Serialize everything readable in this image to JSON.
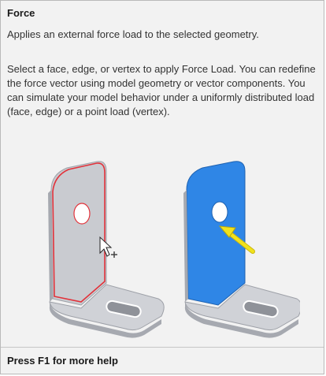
{
  "tooltip": {
    "title": "Force",
    "summary": "Applies an external force load to the selected geometry.",
    "description": "Select a face, edge, or vertex to apply Force Load. You can redefine the force vector using model geometry or vector components. You can simulate your model behavior under a uniformly distributed load (face, edge) or a point load (vertex).",
    "footer": "Press F1 for more help"
  },
  "illustration": {
    "colors": {
      "bracket": "#c9cbd0",
      "bracket_shade": "#a6a9b0",
      "selection_edge": "#e2323a",
      "loaded_face": "#2f86e6",
      "arrow": "#f1e21c"
    },
    "icons": [
      "bracket-left",
      "bracket-right",
      "cursor-icon",
      "force-arrow-icon"
    ]
  }
}
